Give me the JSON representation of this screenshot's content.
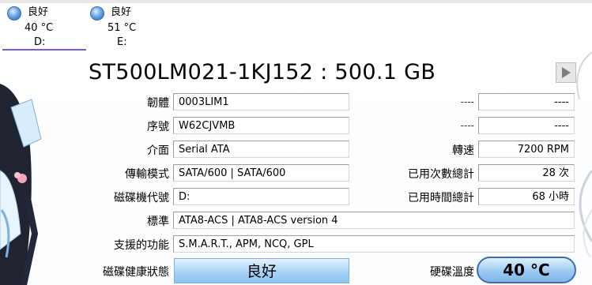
{
  "drives": [
    {
      "status": "良好",
      "temp": "40 °C",
      "letter": "D:"
    },
    {
      "status": "良好",
      "temp": "51 °C",
      "letter": "E:"
    }
  ],
  "disk": {
    "title": "ST500LM021-1KJ152 : 500.1 GB"
  },
  "fields": {
    "firmware": {
      "label": "韌體",
      "value": "0003LIM1"
    },
    "serial": {
      "label": "序號",
      "value": "W62CJVMB"
    },
    "interface": {
      "label": "介面",
      "value": "Serial ATA"
    },
    "transfer": {
      "label": "傳輸模式",
      "value": "SATA/600 | SATA/600"
    },
    "drive_letter": {
      "label": "磁碟機代號",
      "value": "D:"
    },
    "standard": {
      "label": "標準",
      "value": "ATA8-ACS | ATA8-ACS version 4"
    },
    "features": {
      "label": "支援的功能",
      "value": "S.M.A.R.T., APM, NCQ, GPL"
    },
    "health": {
      "label": "磁碟健康狀態",
      "value": "良好"
    }
  },
  "right_fields": {
    "blank1": {
      "label": "----",
      "value": "----"
    },
    "blank2": {
      "label": "----",
      "value": "----"
    },
    "rpm": {
      "label": "轉速",
      "value": "7200 RPM"
    },
    "power_on_count": {
      "label": "已用次數總計",
      "value": "28 次"
    },
    "power_on_hours": {
      "label": "已用時間總計",
      "value": "68 小時"
    },
    "temperature": {
      "label": "硬碟溫度",
      "value": "40 °C"
    }
  },
  "colors": {
    "accent": "#7b5cc9",
    "health_blue": "#a9d3f5",
    "temp_border": "#3d6db0"
  }
}
